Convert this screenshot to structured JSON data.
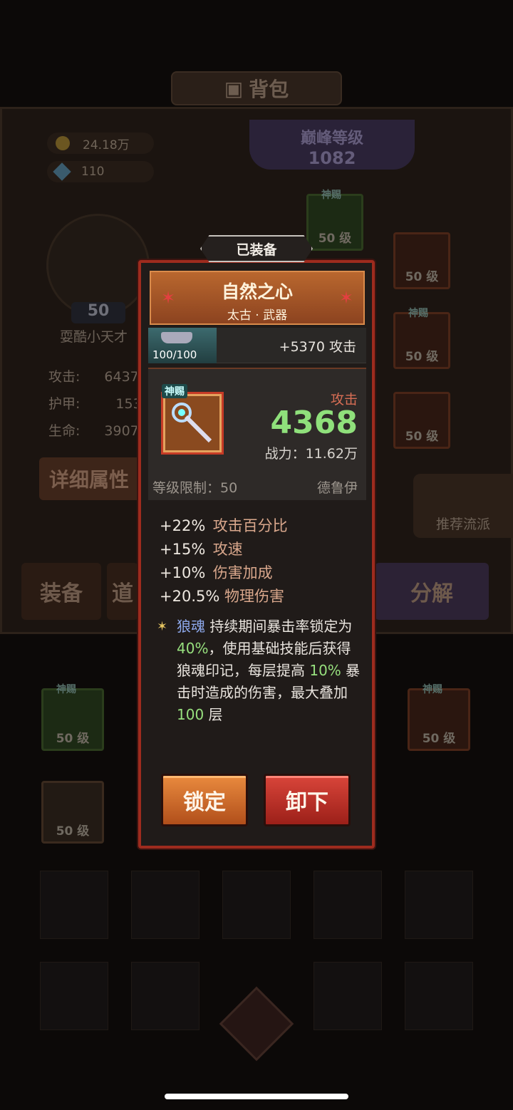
{
  "background": {
    "title": "背包",
    "gold": "24.18万",
    "gems": "110",
    "peak_label": "巅峰等级",
    "peak_value": "1082",
    "player_level": "50",
    "player_name": "耍酷小天才",
    "stats": [
      {
        "label": "攻击:",
        "value": "6437"
      },
      {
        "label": "护甲:",
        "value": "153"
      },
      {
        "label": "生命:",
        "value": "3907"
      }
    ],
    "detail_button": "详细属性",
    "recommend_button": "推荐流派",
    "slot_level": "50 级",
    "slot_tag": "神赐",
    "tabs": {
      "equip": "装备",
      "items": "道",
      "decompose": "分解"
    }
  },
  "popup": {
    "equipped_tag": "已装备",
    "item_name": "自然之心",
    "item_type": "太古 · 武器",
    "enhance_count": "100/100",
    "enhance_bonus": "+5370 攻击",
    "item_tag": "神赐",
    "attack_label": "攻击",
    "attack_value": "4368",
    "power": "战力：11.62万",
    "level_limit": "等级限制：50",
    "class_name": "德鲁伊",
    "affixes": [
      {
        "value": "+22%",
        "label": "攻击百分比"
      },
      {
        "value": "+15%",
        "label": "攻速"
      },
      {
        "value": "+10%",
        "label": "伤害加成"
      },
      {
        "value": "+20.5%",
        "label": "物理伤害"
      }
    ],
    "skill": {
      "star": "✶",
      "name": "狼魂",
      "text_1": " 持续期间暴击率锁定为 ",
      "value_1": "40%",
      "text_2": "，使用基础技能后获得狼魂印记，每层提高 ",
      "value_2": "10%",
      "text_3": " 暴击时造成的伤害，最大叠加 ",
      "value_3": "100",
      "text_4": " 层"
    },
    "lock_button": "锁定",
    "unequip_button": "卸下"
  }
}
